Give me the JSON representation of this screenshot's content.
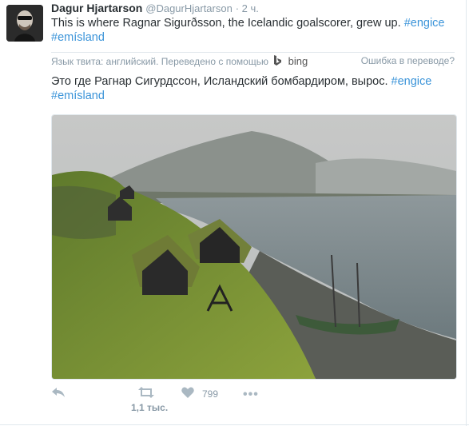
{
  "tweet": {
    "name": "Dagur Hjartarson",
    "handle": "@DagurHjartarson",
    "time": "· 2 ч.",
    "text_main": "This is where Ragnar Sigurðsson, the Icelandic goalscorer, grew up.",
    "hashtag1": "#engice",
    "hashtag2": "#emísland"
  },
  "translation": {
    "label": "Язык твита: английский. Переведено с помощью",
    "provider": "bing",
    "error_link": "Ошибка в переводе?",
    "text": "Это где Рагнар Сигурдссон, Исландский бомбардиром, вырос.",
    "hashtag1": "#engice",
    "hashtag2": "#emísland"
  },
  "actions": {
    "retweets_count": "1,1 тыс.",
    "likes_count": "799"
  },
  "colors": {
    "link": "#3b94d9",
    "muted": "#8899a6",
    "text": "#292f33"
  }
}
